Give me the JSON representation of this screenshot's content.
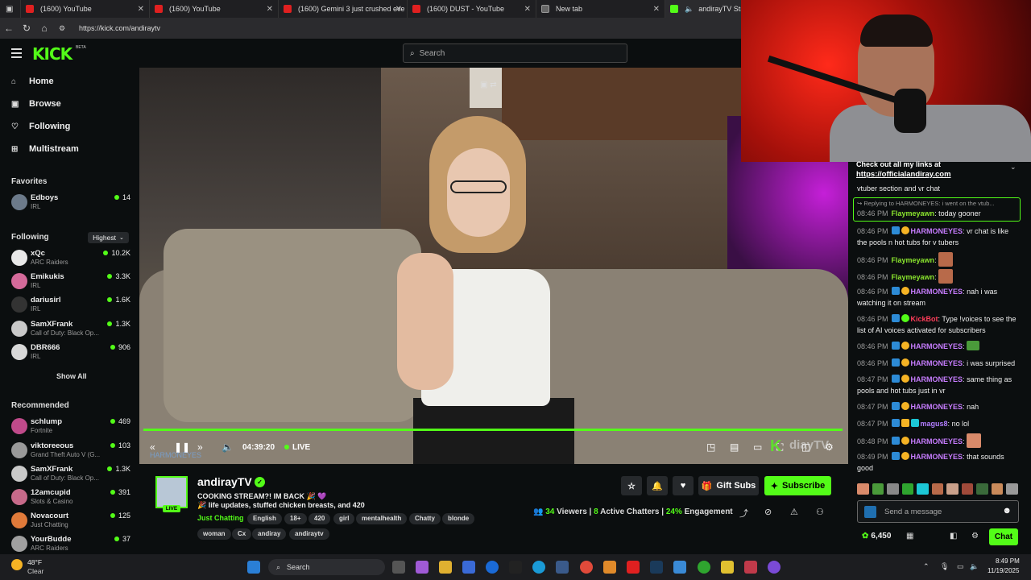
{
  "browser": {
    "tabs": [
      {
        "label": "(1600) YouTube",
        "color": "#e02020"
      },
      {
        "label": "(1600) YouTube",
        "color": "#e02020"
      },
      {
        "label": "(1600) Gemini 3 just crushed eve",
        "color": "#e02020"
      },
      {
        "label": "(1600) DUST - YouTube",
        "color": "#e02020"
      },
      {
        "label": "New tab",
        "color": "#888888"
      },
      {
        "label": "andirayTV Stream",
        "color": "#53fc18"
      }
    ],
    "url": "https://kick.com/andiraytv"
  },
  "header": {
    "logo": "KICK",
    "beta": "BETA",
    "search_placeholder": "Search"
  },
  "sidebar": {
    "nav": [
      {
        "label": "Home",
        "icon": "⌂"
      },
      {
        "label": "Browse",
        "icon": "▣"
      },
      {
        "label": "Following",
        "icon": "♡"
      },
      {
        "label": "Multistream",
        "icon": "⊞"
      }
    ],
    "favorites_title": "Favorites",
    "favorites": [
      {
        "name": "Edboys",
        "category": "IRL",
        "viewers": "14",
        "color": "#6c7a8a"
      }
    ],
    "following_title": "Following",
    "sort_label": "Highest",
    "following": [
      {
        "name": "xQc",
        "category": "ARC Raiders",
        "viewers": "10.2K",
        "color": "#e8e8e8"
      },
      {
        "name": "Emikukis",
        "category": "IRL",
        "viewers": "3.3K",
        "color": "#d46a9a"
      },
      {
        "name": "dariusirl",
        "category": "IRL",
        "viewers": "1.6K",
        "color": "#333333"
      },
      {
        "name": "SamXFrank",
        "category": "Call of Duty: Black Op...",
        "viewers": "1.3K",
        "color": "#c9c9c9"
      },
      {
        "name": "DBR666",
        "category": "IRL",
        "viewers": "906",
        "color": "#d8d8d8"
      }
    ],
    "show_all": "Show All",
    "recommended_title": "Recommended",
    "recommended": [
      {
        "name": "schlump",
        "category": "Fortnite",
        "viewers": "469",
        "color": "#c04a8a"
      },
      {
        "name": "viktoreeous",
        "category": "Grand Theft Auto V (G...",
        "viewers": "103",
        "color": "#999999"
      },
      {
        "name": "SamXFrank",
        "category": "Call of Duty: Black Op...",
        "viewers": "1.3K",
        "color": "#c9c9c9"
      },
      {
        "name": "12amcupid",
        "category": "Slots & Casino",
        "viewers": "391",
        "color": "#c76a8a"
      },
      {
        "name": "Novacourt",
        "category": "Just Chatting",
        "viewers": "125",
        "color": "#e07a3a"
      },
      {
        "name": "YourBudde",
        "category": "ARC Raiders",
        "viewers": "37",
        "color": "#a0a0a0"
      }
    ]
  },
  "player": {
    "time": "04:39:20",
    "live_label": "LIVE",
    "progress": 1.0,
    "watermark_name": "HARMONEYES",
    "watermark_brand": "diayTV"
  },
  "channel": {
    "name": "andirayTV",
    "live_badge": "LIVE",
    "title_line1": "COOKING STREAM?! IM BACK 🎉 💜",
    "title_line2": "🎉 life updates, stuffed chicken breasts, and 420",
    "category": "Just Chatting",
    "tags_row1": [
      "English",
      "18+",
      "420",
      "girl",
      "mentalhealth",
      "Chatty",
      "blonde"
    ],
    "tags_row2": [
      "woman",
      "Cx",
      "andiray",
      "andiraytv"
    ],
    "gift_subs": "Gift Subs",
    "subscribe": "Subscribe",
    "viewers": "34",
    "viewers_label": "Viewers",
    "chatters": "8",
    "chatters_label": "Active Chatters",
    "engagement": "24%",
    "engagement_label": "Engagement"
  },
  "chat": {
    "pinned_text": "Check out all my links at",
    "pinned_link": "https://officialandiray.com",
    "messages": [
      {
        "time": "",
        "user": "",
        "text": "vtuber section and vr chat",
        "color": "#eeeeee"
      },
      {
        "time": "",
        "user": "",
        "text": "↪ Replying to HARMONEYES: i went on the vtub...",
        "color": "#9a9a9a"
      },
      {
        "time": "08:46 PM",
        "user": "Flaymeyawn",
        "text": "today gooner",
        "color": "#8be62e"
      },
      {
        "time": "08:46 PM",
        "user": "HARMONEYES",
        "text": "vr chat is like the pools n hot tubs for v tubers",
        "color": "#c77dff"
      },
      {
        "time": "08:46 PM",
        "user": "Flaymeyawn",
        "text": "",
        "color": "#8be62e"
      },
      {
        "time": "08:46 PM",
        "user": "Flaymeyawn",
        "text": "",
        "color": "#8be62e"
      },
      {
        "time": "08:46 PM",
        "user": "HARMONEYES",
        "text": "nah i was watching it on stream",
        "color": "#c77dff"
      },
      {
        "time": "08:46 PM",
        "user": "KickBot",
        "text": "Type !voices to see the list of AI voices activated for subscribers",
        "color": "#ff3d5a"
      },
      {
        "time": "08:46 PM",
        "user": "HARMONEYES",
        "text": "",
        "color": "#c77dff"
      },
      {
        "time": "08:46 PM",
        "user": "HARMONEYES",
        "text": "i was surprised",
        "color": "#c77dff"
      },
      {
        "time": "08:47 PM",
        "user": "HARMONEYES",
        "text": "same thing as pools and hot tubs just in vr",
        "color": "#c77dff"
      },
      {
        "time": "08:47 PM",
        "user": "HARMONEYES",
        "text": "nah",
        "color": "#c77dff"
      },
      {
        "time": "08:47 PM",
        "user": "magus8",
        "text": "no lol",
        "color": "#b27dff"
      },
      {
        "time": "08:48 PM",
        "user": "HARMONEYES",
        "text": "",
        "color": "#c77dff"
      },
      {
        "time": "08:49 PM",
        "user": "HARMONEYES",
        "text": "that sounds good",
        "color": "#c77dff"
      }
    ],
    "input_placeholder": "Send a message",
    "points": "6,450",
    "chat_button": "Chat"
  },
  "taskbar": {
    "weather_temp": "48°F",
    "weather_cond": "Clear",
    "search_label": "Search",
    "time": "8:49 PM",
    "date": "11/19/2025"
  }
}
